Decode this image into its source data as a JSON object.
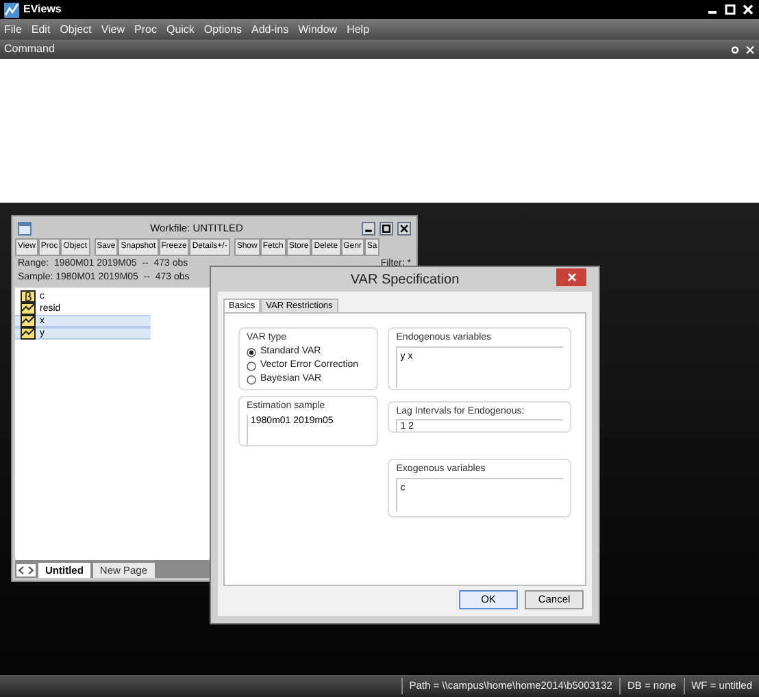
{
  "app": {
    "title": "EViews"
  },
  "menu": [
    "File",
    "Edit",
    "Object",
    "View",
    "Proc",
    "Quick",
    "Options",
    "Add-ins",
    "Window",
    "Help"
  ],
  "command_pane": {
    "title": "Command"
  },
  "workfile": {
    "title": "Workfile: UNTITLED",
    "toolbar": [
      "View",
      "Proc",
      "Object",
      "Save",
      "Snapshot",
      "Freeze",
      "Details+/-",
      "Show",
      "Fetch",
      "Store",
      "Delete",
      "Genr",
      "Sa"
    ],
    "range": "Range:  1980M01 2019M05  --  473 obs",
    "filter": "Filter: *",
    "sample": "Sample: 1980M01 2019M05  --  473 obs",
    "objects": [
      {
        "name": "c",
        "kind": "coef",
        "selected": false
      },
      {
        "name": "resid",
        "kind": "series",
        "selected": false
      },
      {
        "name": "x",
        "kind": "series",
        "selected": true
      },
      {
        "name": "y",
        "kind": "series",
        "selected": true
      }
    ],
    "pages": [
      {
        "label": "Untitled",
        "selected": true
      },
      {
        "label": "New Page",
        "selected": false
      }
    ]
  },
  "dialog": {
    "title": "VAR Specification",
    "tabs": [
      {
        "label": "Basics",
        "selected": true
      },
      {
        "label": "VAR Restrictions",
        "selected": false
      }
    ],
    "var_type": {
      "label": "VAR type",
      "options": [
        {
          "label": "Standard VAR",
          "selected": true
        },
        {
          "label": "Vector Error Correction",
          "selected": false
        },
        {
          "label": "Bayesian VAR",
          "selected": false
        }
      ]
    },
    "estimation_sample": {
      "label": "Estimation sample",
      "value": "1980m01 2019m05"
    },
    "endogenous": {
      "label": "Endogenous variables",
      "value": "y x"
    },
    "lag_intervals": {
      "label": "Lag Intervals for Endogenous:",
      "value": "1 2"
    },
    "exogenous": {
      "label": "Exogenous variables",
      "value": "c"
    },
    "buttons": [
      "OK",
      "Cancel"
    ]
  },
  "status_bar": [
    "Path = \\\\campus\\home\\home2014\\b5003132",
    "DB = none",
    "WF = untitled"
  ]
}
